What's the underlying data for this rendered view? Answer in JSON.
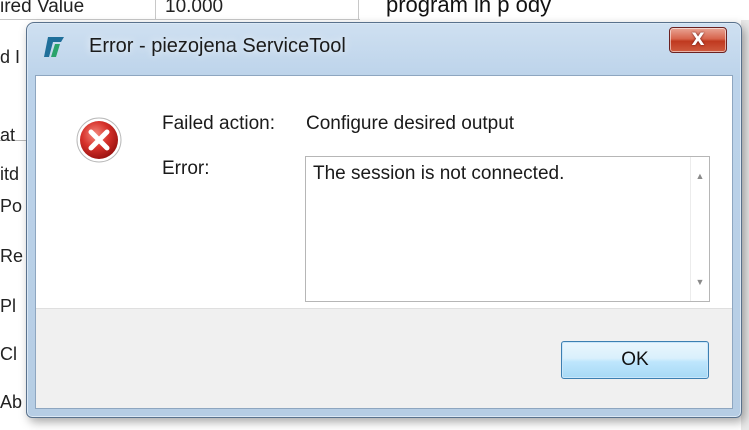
{
  "background": {
    "grid_row": {
      "label": "ired Value",
      "value": "10.000"
    },
    "top_text": "program in p            ody",
    "side_labels": [
      "d I",
      "at",
      "itd",
      "Po",
      "Re",
      "Pl",
      "Cl",
      "Ab"
    ]
  },
  "dialog": {
    "title": "Error - piezojena ServiceTool",
    "close_glyph": "X",
    "failed_action_label": "Failed action:",
    "failed_action_value": "Configure desired output",
    "error_label": "Error:",
    "error_message": "The session is not connected.",
    "ok_label": "OK",
    "icons": [
      "app-icon",
      "error-icon",
      "close-icon",
      "scroll-up-icon",
      "scroll-down-icon"
    ],
    "colors": {
      "title_bar": "#bcd3ea",
      "close_button": "#c0391f",
      "error_icon": "#c4201c",
      "ok_button": "#bee6fd",
      "app_icon": "#1f6f9a"
    }
  }
}
